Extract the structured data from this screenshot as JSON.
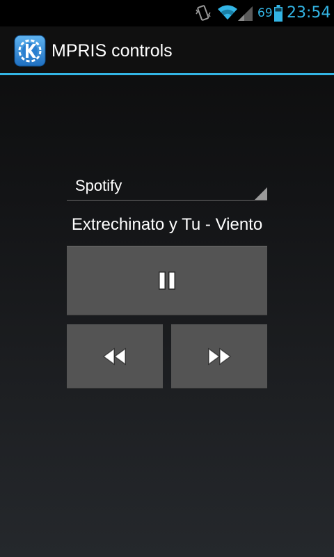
{
  "status_bar": {
    "battery_percent": "69",
    "time": "23:54",
    "accent_color": "#33b5e5",
    "icons": [
      "vibrate-icon",
      "wifi-icon",
      "signal-icon",
      "battery-icon"
    ]
  },
  "action_bar": {
    "title": "MPRIS controls",
    "icon": "kde-logo-icon"
  },
  "player_select": {
    "selected": "Spotify"
  },
  "now_playing": {
    "title": "Extrechinato y Tu - Viento"
  },
  "controls": {
    "play_pause_icon": "pause-icon",
    "previous_icon": "rewind-icon",
    "next_icon": "fast-forward-icon"
  }
}
